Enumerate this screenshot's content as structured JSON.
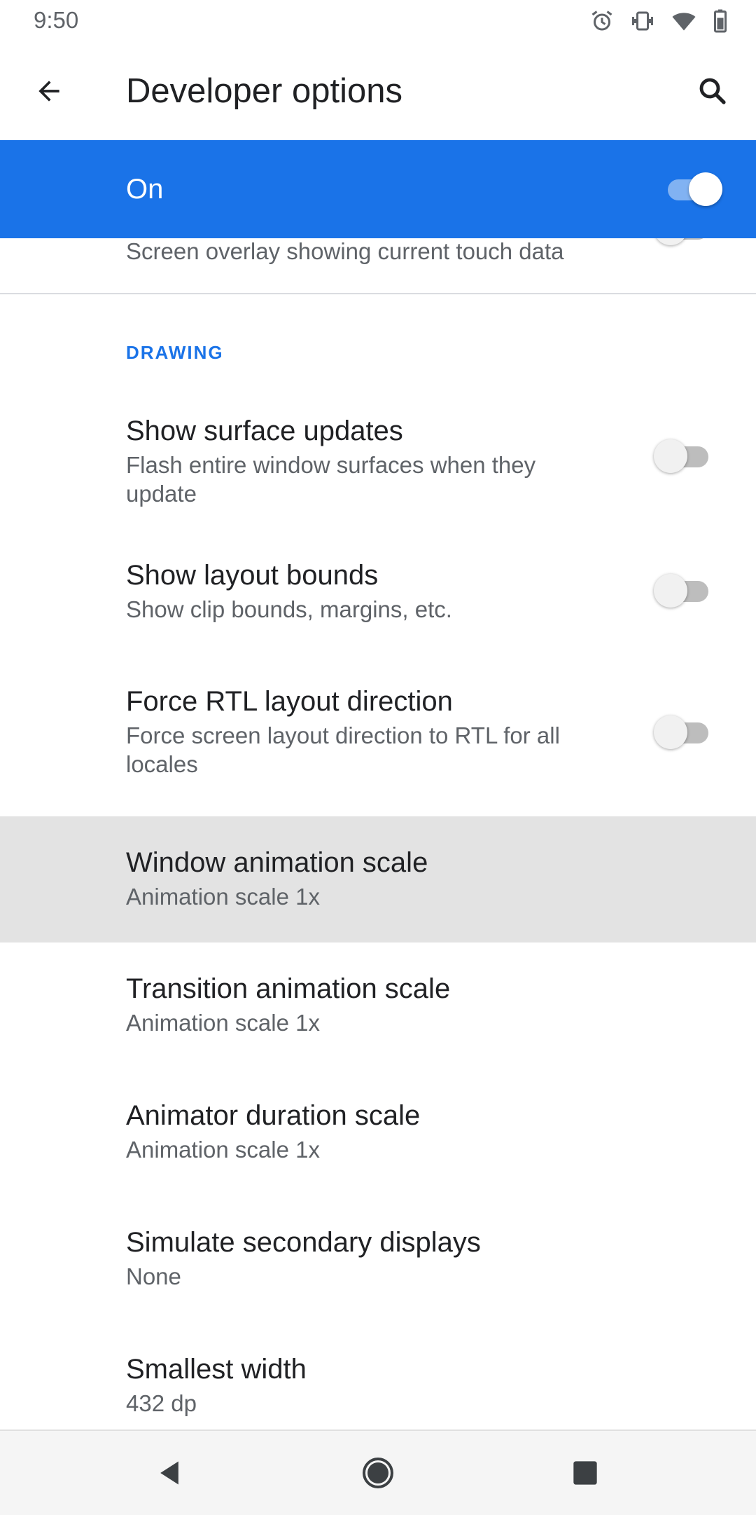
{
  "status_bar": {
    "time": "9:50",
    "icons": [
      "alarm-icon",
      "vibrate-icon",
      "wifi-icon",
      "battery-icon"
    ]
  },
  "app_bar": {
    "title": "Developer options",
    "back_icon": "arrow-back-icon",
    "search_icon": "search-icon"
  },
  "master_switch": {
    "label": "On",
    "checked": true,
    "color": "#1a73e8"
  },
  "partial_item": {
    "summary": "Screen overlay showing current touch data"
  },
  "category": {
    "label": "DRAWING"
  },
  "preferences": [
    {
      "title": "Show surface updates",
      "summary": "Flash entire window surfaces when they update",
      "switch": false
    },
    {
      "title": "Show layout bounds",
      "summary": "Show clip bounds, margins, etc.",
      "switch": false
    },
    {
      "title": "Force RTL layout direction",
      "summary": "Force screen layout direction to RTL for all locales",
      "switch": false
    },
    {
      "title": "Window animation scale",
      "summary": "Animation scale 1x",
      "highlighted": true
    },
    {
      "title": "Transition animation scale",
      "summary": "Animation scale 1x"
    },
    {
      "title": "Animator duration scale",
      "summary": "Animation scale 1x"
    },
    {
      "title": "Simulate secondary displays",
      "summary": "None"
    },
    {
      "title": "Smallest width",
      "summary": "432 dp"
    }
  ],
  "nav_bar": {
    "back_icon": "nav-back-icon",
    "home_icon": "nav-home-icon",
    "recents_icon": "nav-recents-icon"
  }
}
